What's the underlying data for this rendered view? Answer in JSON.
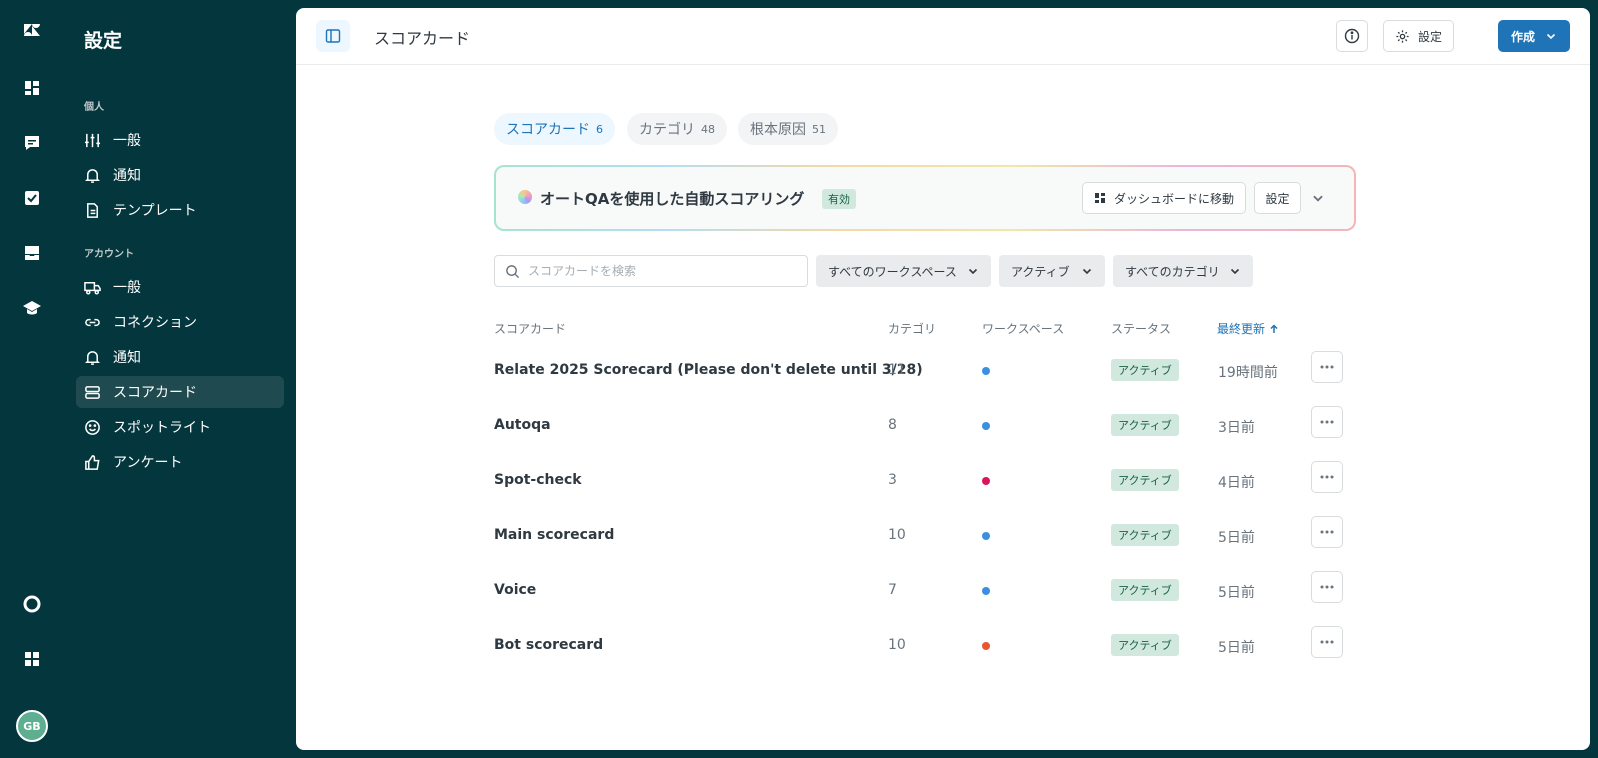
{
  "rail": {
    "avatar_initials": "GB",
    "icons": [
      "zendesk-logo-icon",
      "dashboard-icon",
      "chat-icon",
      "checkbox-icon",
      "inbox-icon",
      "graduation-cap-icon",
      "help-lifebuoy-icon",
      "apps-grid-icon"
    ]
  },
  "nav": {
    "title": "設定",
    "section_personal": "個人",
    "section_account": "アカウント",
    "personal_items": [
      {
        "label": "一般",
        "icon": "sliders-icon"
      },
      {
        "label": "通知",
        "icon": "bell-icon"
      },
      {
        "label": "テンプレート",
        "icon": "document-icon"
      }
    ],
    "account_items": [
      {
        "label": "一般",
        "icon": "truck-icon"
      },
      {
        "label": "コネクション",
        "icon": "link-icon"
      },
      {
        "label": "通知",
        "icon": "bell-icon"
      },
      {
        "label": "スコアカード",
        "icon": "scorecard-icon"
      },
      {
        "label": "スポットライト",
        "icon": "smiley-icon"
      },
      {
        "label": "アンケート",
        "icon": "thumbs-up-icon"
      }
    ]
  },
  "header": {
    "title": "スコアカード",
    "settings_label": "設定",
    "create_label": "作成"
  },
  "tabs": [
    {
      "label": "スコアカード",
      "count": "6"
    },
    {
      "label": "カテゴリ",
      "count": "48"
    },
    {
      "label": "根本原因",
      "count": "51"
    }
  ],
  "banner": {
    "title": "オートQAを使用した自動スコアリング",
    "badge": "有効",
    "dashboard_label": "ダッシュボードに移動",
    "settings_label": "設定"
  },
  "filters": {
    "search_placeholder": "スコアカードを検索",
    "workspace": "すべてのワークスペース",
    "status": "アクティブ",
    "category": "すべてのカテゴリ"
  },
  "table": {
    "headers": {
      "name": "スコアカード",
      "category": "カテゴリ",
      "workspace": "ワークスペース",
      "status": "ステータス",
      "updated": "最終更新"
    },
    "rows": [
      {
        "name": "Relate 2025 Scorecard (Please don't delete until 3/28)",
        "categories": "11",
        "ws_color": "#3b8fe0",
        "status": "アクティブ",
        "updated": "19時間前"
      },
      {
        "name": "Autoqa",
        "categories": "8",
        "ws_color": "#3b8fe0",
        "status": "アクティブ",
        "updated": "3日前"
      },
      {
        "name": "Spot-check",
        "categories": "3",
        "ws_color": "#d6175f",
        "status": "アクティブ",
        "updated": "4日前"
      },
      {
        "name": "Main scorecard",
        "categories": "10",
        "ws_color": "#3b8fe0",
        "status": "アクティブ",
        "updated": "5日前"
      },
      {
        "name": "Voice",
        "categories": "7",
        "ws_color": "#3b8fe0",
        "status": "アクティブ",
        "updated": "5日前"
      },
      {
        "name": "Bot scorecard",
        "categories": "10",
        "ws_color": "#e8552f",
        "status": "アクティブ",
        "updated": "5日前"
      }
    ]
  }
}
